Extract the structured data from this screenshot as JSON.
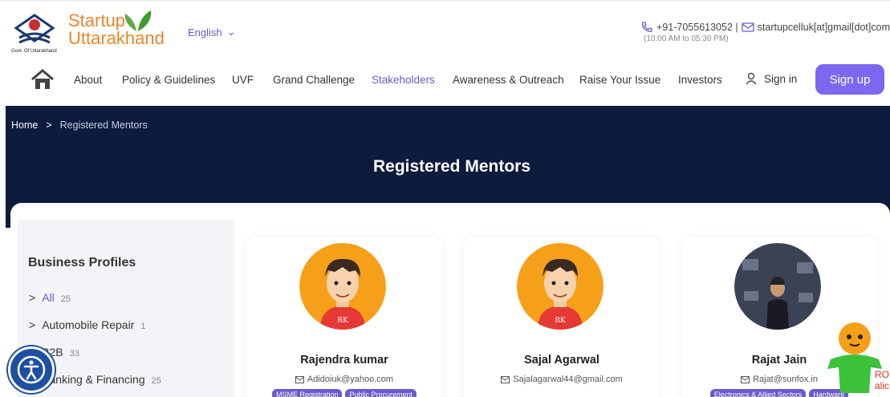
{
  "header": {
    "gov_label": "Govt. Of Uttarakhand",
    "brand_line1": "Startup",
    "brand_line2": "Uttarakhand",
    "language": "English",
    "phone": "+91-7055613052 |",
    "email": "startupcelluk[at]gmail[dot]com",
    "hours": "(10:00 AM to 05:30 PM)"
  },
  "nav": {
    "items": [
      {
        "label": "About"
      },
      {
        "label": "Policy & Guidelines"
      },
      {
        "label": "UVF"
      },
      {
        "label": "Grand Challenge"
      },
      {
        "label": "Stakeholders"
      },
      {
        "label": "Awareness & Outreach"
      },
      {
        "label": "Raise Your Issue"
      },
      {
        "label": "Investors"
      }
    ],
    "signin": "Sign in",
    "signup": "Sign up"
  },
  "hero": {
    "breadcrumb_home": "Home",
    "breadcrumb_sep": ">",
    "breadcrumb_current": "Registered Mentors",
    "title": "Registered Mentors"
  },
  "sidebar": {
    "title": "Business Profiles",
    "items": [
      {
        "label": "All",
        "count": "25"
      },
      {
        "label": "Automobile Repair",
        "count": "1"
      },
      {
        "label": "B2B",
        "count": "33"
      },
      {
        "label": "Banking & Financing",
        "count": "25"
      }
    ]
  },
  "mentors": [
    {
      "name": "Rajendra kumar",
      "email": "Adidoiuk@yahoo.com",
      "tags": [
        "MSME Registration",
        "Public Procurement"
      ],
      "avatar_text": "RK"
    },
    {
      "name": "Sajal Agarwal",
      "email": "Sajalagarwal44@gmail.com",
      "tags": [],
      "avatar_text": "RK"
    },
    {
      "name": "Rajat Jain",
      "email": "Rajat@sunfox.in",
      "tags": [
        "Electronics & Allied Sectors",
        "Hardware"
      ],
      "avatar_text": ""
    }
  ],
  "chatbot": {
    "text_line1": "ROI",
    "text_line2": "alic"
  },
  "colors": {
    "accent": "#6a5acd",
    "brand": "#e8862a",
    "hero_bg": "#0d1b3d",
    "signup_bg": "#7b68ee"
  }
}
